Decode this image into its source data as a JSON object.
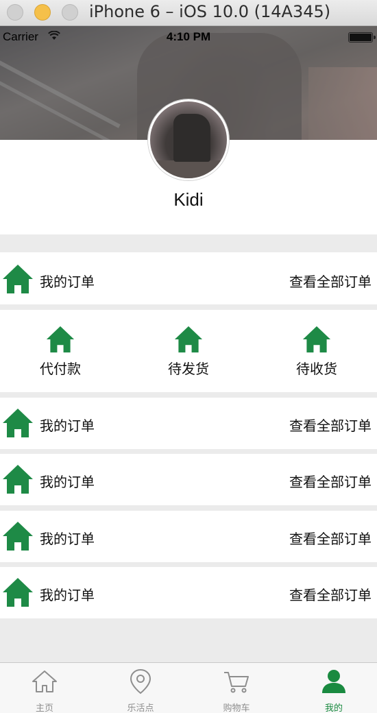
{
  "window": {
    "title": "iPhone 6 – iOS 10.0 (14A345)"
  },
  "status_bar": {
    "carrier": "Carrier",
    "time": "4:10 PM"
  },
  "profile": {
    "username": "Kidi"
  },
  "order_row": {
    "label": "我的订单",
    "link": "查看全部订单"
  },
  "order_status": [
    {
      "label": "代付款",
      "icon": "home-icon"
    },
    {
      "label": "待发货",
      "icon": "home-icon"
    },
    {
      "label": "待收货",
      "icon": "home-icon"
    }
  ],
  "rows": [
    {
      "label": "我的订单",
      "link": "查看全部订单",
      "icon": "home-icon"
    },
    {
      "label": "我的订单",
      "link": "查看全部订单",
      "icon": "home-icon"
    },
    {
      "label": "我的订单",
      "link": "查看全部订单",
      "icon": "home-icon"
    },
    {
      "label": "我的订单",
      "link": "查看全部订单",
      "icon": "home-icon"
    }
  ],
  "tabs": [
    {
      "label": "主页",
      "icon": "home-outline-icon",
      "active": false
    },
    {
      "label": "乐活点",
      "icon": "location-pin-icon",
      "active": false
    },
    {
      "label": "购物车",
      "icon": "cart-icon",
      "active": false
    },
    {
      "label": "我的",
      "icon": "person-icon",
      "active": true
    }
  ],
  "colors": {
    "accent": "#1a8a40",
    "icon_green": "#1e8a46",
    "inactive_tab": "#8e8e8e",
    "separator": "#ebebeb"
  }
}
